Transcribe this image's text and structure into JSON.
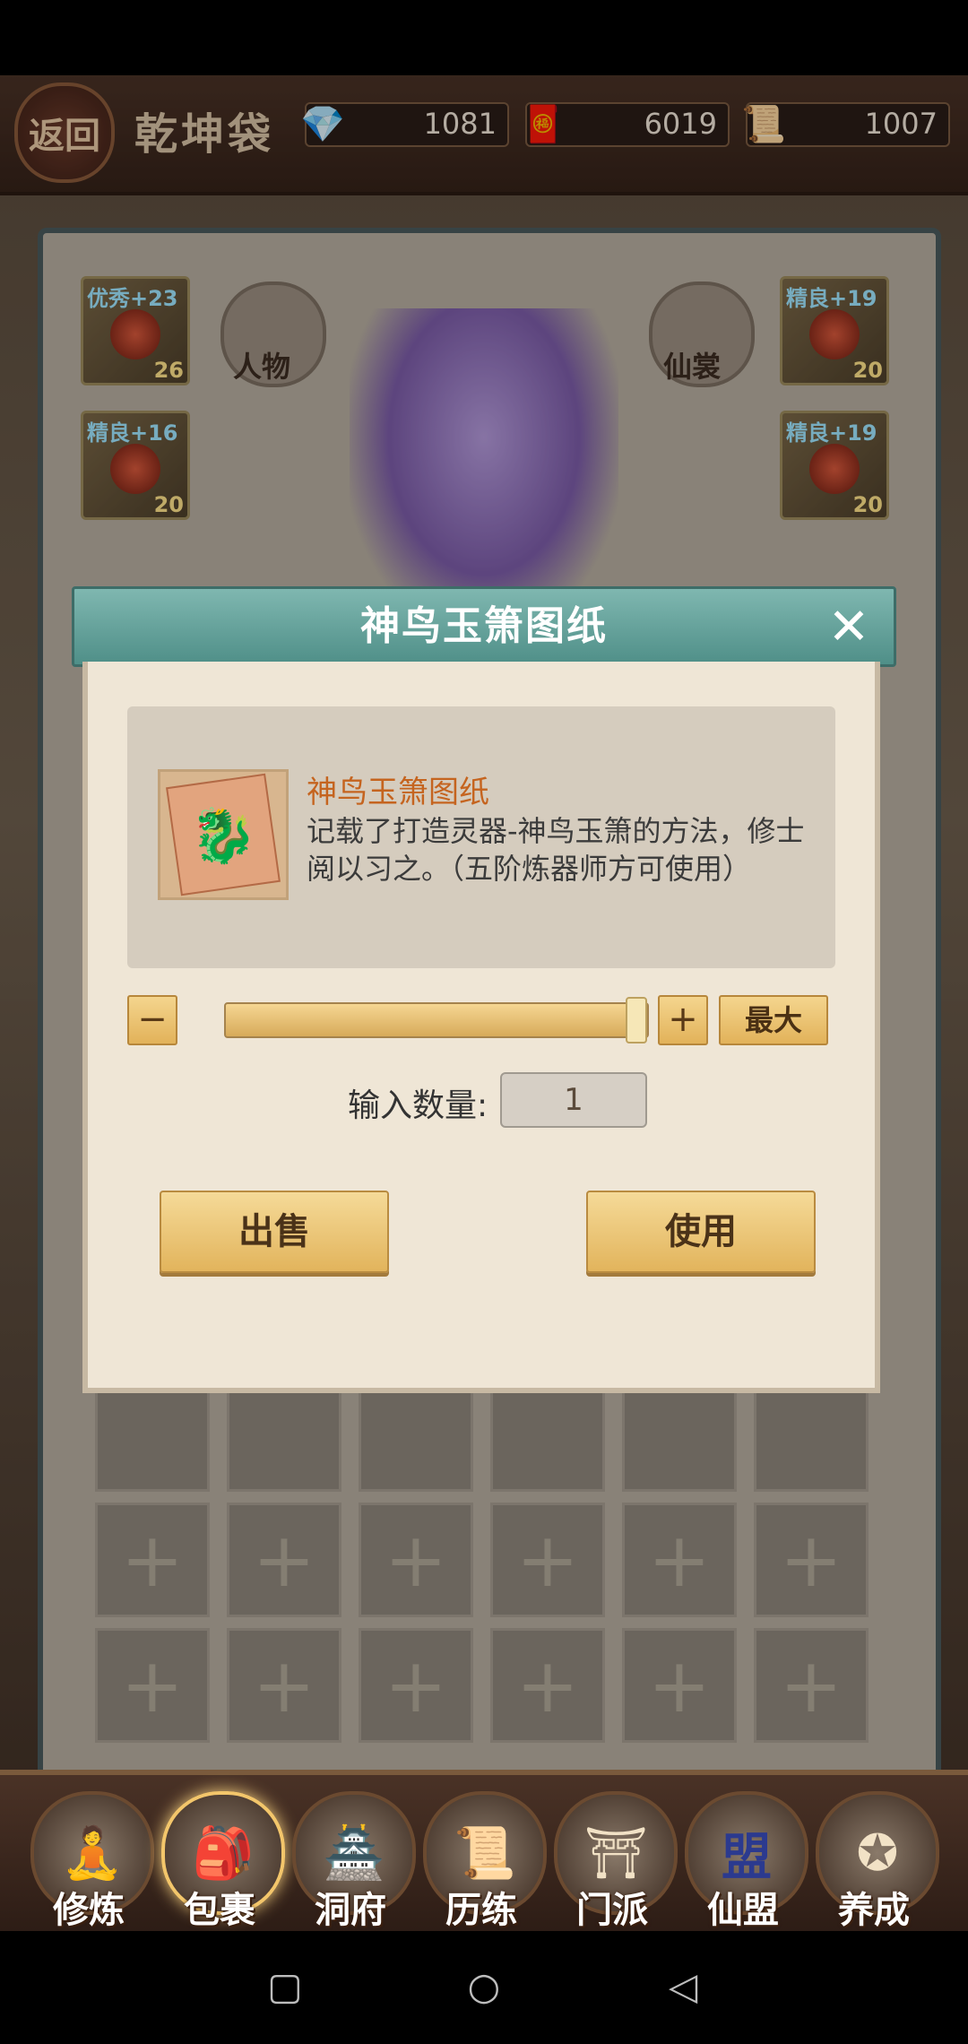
{
  "header": {
    "back_label": "返回",
    "title": "乾坤袋",
    "resources": [
      {
        "icon": "crystal-icon",
        "value": "1081"
      },
      {
        "icon": "token-icon",
        "value": "6019"
      },
      {
        "icon": "scroll-icon",
        "value": "1007"
      }
    ]
  },
  "equipment": {
    "left_top": {
      "tag": "优秀+23",
      "level": "26"
    },
    "left_mid": {
      "tag": "精良+16",
      "level": "20"
    },
    "right_top": {
      "tag": "精良+19",
      "level": "20"
    },
    "right_mid": {
      "tag": "精良+19",
      "level": "20"
    },
    "character_btn": "人物",
    "costume_btn": "仙裳"
  },
  "dialog": {
    "title": "神鸟玉箫图纸",
    "item_name": "神鸟玉箫图纸",
    "item_desc": "记载了打造灵器-神鸟玉箫的方法，修士阅以习之。（五阶炼器师方可使用）",
    "minus": "−",
    "plus": "+",
    "max_label": "最大",
    "qty_label": "输入数量:",
    "qty_value": "1",
    "slider_level": 1.0,
    "sell_label": "出售",
    "use_label": "使用"
  },
  "bottom_nav": [
    {
      "label": "修炼",
      "icon": "cultivator-icon"
    },
    {
      "label": "包裹",
      "icon": "bag-icon",
      "active": true
    },
    {
      "label": "洞府",
      "icon": "cave-icon"
    },
    {
      "label": "历练",
      "icon": "training-scroll-icon"
    },
    {
      "label": "门派",
      "icon": "sect-gate-icon"
    },
    {
      "label": "仙盟",
      "icon": "alliance-icon",
      "badge": "盟"
    },
    {
      "label": "养成",
      "icon": "pentagram-icon"
    }
  ]
}
